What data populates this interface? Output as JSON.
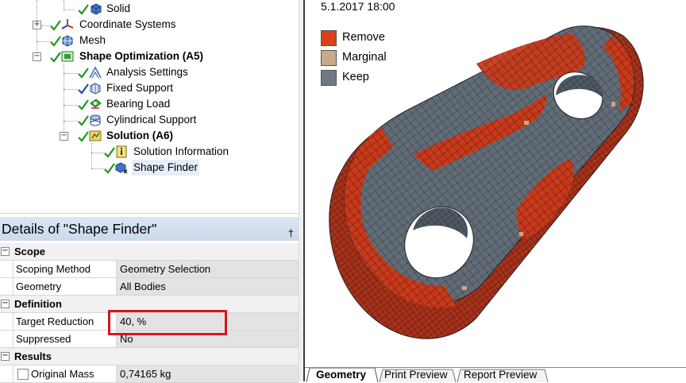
{
  "tree": {
    "items": [
      {
        "label": "Solid",
        "bold": false
      },
      {
        "label": "Coordinate Systems",
        "bold": false
      },
      {
        "label": "Mesh",
        "bold": false
      },
      {
        "label": "Shape Optimization (A5)",
        "bold": true
      },
      {
        "label": "Analysis Settings",
        "bold": false
      },
      {
        "label": "Fixed Support",
        "bold": false
      },
      {
        "label": "Bearing Load",
        "bold": false
      },
      {
        "label": "Cylindrical Support",
        "bold": false
      },
      {
        "label": "Solution (A6)",
        "bold": true
      },
      {
        "label": "Solution Information",
        "bold": false
      },
      {
        "label": "Shape Finder",
        "bold": false
      }
    ]
  },
  "details": {
    "title": "Details of \"Shape Finder\"",
    "pin": "†",
    "sections": {
      "scope": "Scope",
      "definition": "Definition",
      "results": "Results"
    },
    "rows": {
      "scoping_method": {
        "key": "Scoping Method",
        "value": "Geometry Selection"
      },
      "geometry": {
        "key": "Geometry",
        "value": "All Bodies"
      },
      "target_reduction": {
        "key": "Target Reduction",
        "value": "40, %"
      },
      "suppressed": {
        "key": "Suppressed",
        "value": "No"
      },
      "original_mass": {
        "key": "Original Mass",
        "value": "0,74165 kg"
      }
    }
  },
  "viewport": {
    "timestamp": "5.1.2017 18:00",
    "legend": [
      {
        "label": "Remove",
        "color": "#d9401b"
      },
      {
        "label": "Marginal",
        "color": "#c9a98a"
      },
      {
        "label": "Keep",
        "color": "#6f7a84"
      }
    ]
  },
  "tabs": [
    "Geometry",
    "Print Preview",
    "Report Preview"
  ]
}
